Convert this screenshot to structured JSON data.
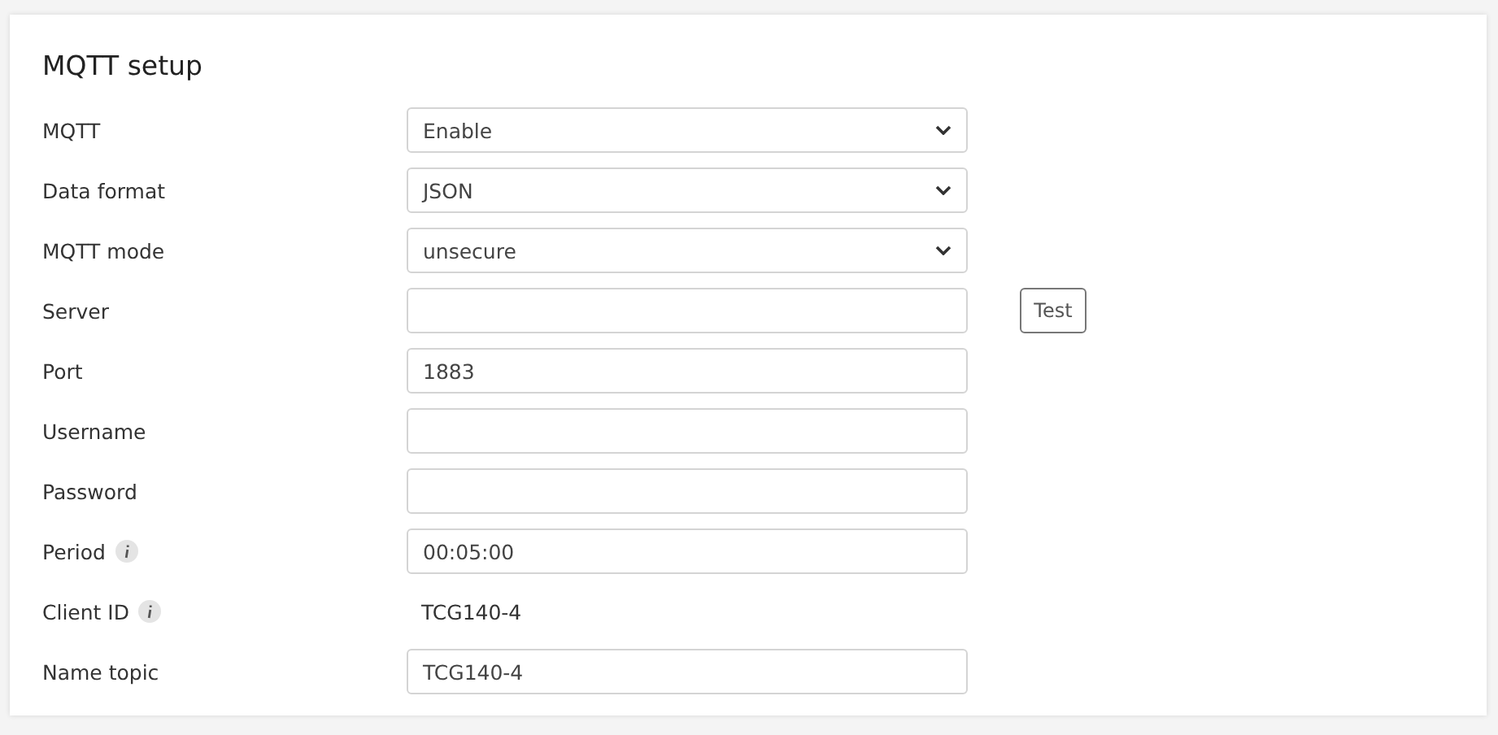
{
  "title": "MQTT setup",
  "rows": [
    {
      "label": "MQTT",
      "kind": "select",
      "value": "Enable",
      "info": false
    },
    {
      "label": "Data format",
      "kind": "select",
      "value": "JSON",
      "info": false
    },
    {
      "label": "MQTT mode",
      "kind": "select",
      "value": "unsecure",
      "info": false
    },
    {
      "label": "Server",
      "kind": "input",
      "value": "",
      "info": false,
      "button": "Test"
    },
    {
      "label": "Port",
      "kind": "input",
      "value": "1883",
      "info": false
    },
    {
      "label": "Username",
      "kind": "input",
      "value": "",
      "info": false
    },
    {
      "label": "Password",
      "kind": "input",
      "value": "",
      "info": false
    },
    {
      "label": "Period",
      "kind": "input",
      "value": "00:05:00",
      "info": true
    },
    {
      "label": "Client ID",
      "kind": "text",
      "value": "TCG140-4",
      "info": true
    },
    {
      "label": "Name topic",
      "kind": "input",
      "value": "TCG140-4",
      "info": false
    }
  ]
}
